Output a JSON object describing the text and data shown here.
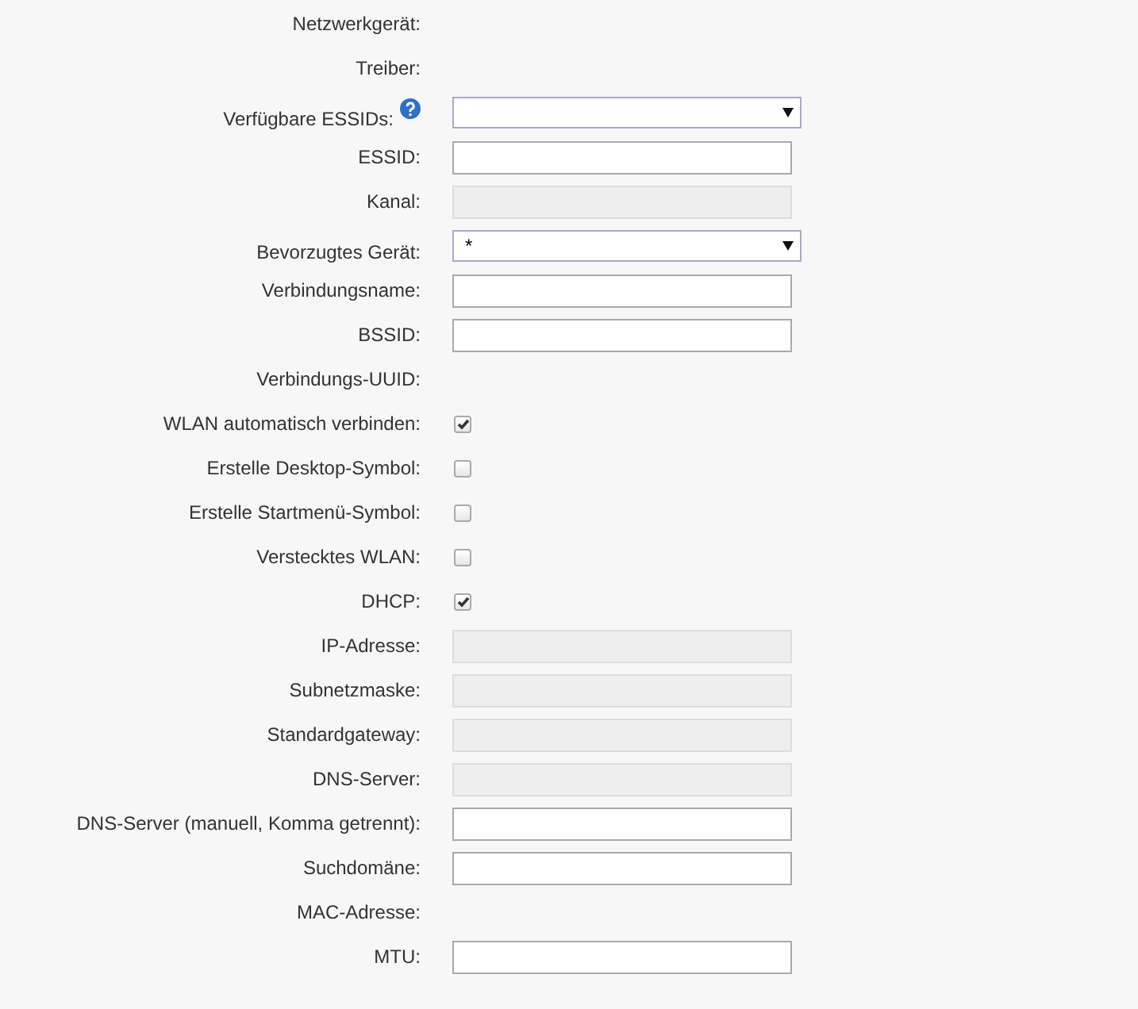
{
  "fields": [
    {
      "label": "Netzwerkgerät:",
      "kind": "text"
    },
    {
      "label": "Treiber:",
      "kind": "text"
    },
    {
      "label": "Verfügbare ESSIDs:",
      "kind": "select",
      "help": true
    },
    {
      "label": "ESSID:",
      "kind": "input",
      "disabled": false
    },
    {
      "label": "Kanal:",
      "kind": "input",
      "disabled": true
    },
    {
      "label": "Bevorzugtes Gerät:",
      "kind": "select",
      "help": false,
      "value": "*"
    },
    {
      "label": "Verbindungsname:",
      "kind": "input",
      "disabled": false
    },
    {
      "label": "BSSID:",
      "kind": "input",
      "disabled": false
    },
    {
      "label": "Verbindungs-UUID:",
      "kind": "text"
    },
    {
      "label": "WLAN automatisch verbinden:",
      "kind": "checkbox",
      "checked": true
    },
    {
      "label": "Erstelle Desktop-Symbol:",
      "kind": "checkbox",
      "checked": false
    },
    {
      "label": "Erstelle Startmenü-Symbol:",
      "kind": "checkbox",
      "checked": false
    },
    {
      "label": "Verstecktes WLAN:",
      "kind": "checkbox",
      "checked": false
    },
    {
      "label": "DHCP:",
      "kind": "checkbox",
      "checked": true
    },
    {
      "label": "IP-Adresse:",
      "kind": "input",
      "disabled": true
    },
    {
      "label": "Subnetzmaske:",
      "kind": "input",
      "disabled": true
    },
    {
      "label": "Standardgateway:",
      "kind": "input",
      "disabled": true
    },
    {
      "label": "DNS-Server:",
      "kind": "input",
      "disabled": true
    },
    {
      "label": "DNS-Server (manuell, Komma getrennt):",
      "kind": "input",
      "disabled": false
    },
    {
      "label": "Suchdomäne:",
      "kind": "input",
      "disabled": false
    },
    {
      "label": "MAC-Adresse:",
      "kind": "text"
    },
    {
      "label": "MTU:",
      "kind": "input",
      "disabled": false
    }
  ]
}
